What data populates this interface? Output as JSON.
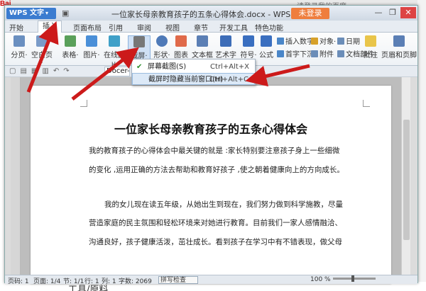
{
  "background": {
    "baidu_logo": "Bai",
    "bg_bottom_text": "工具/原料",
    "bg_top_text": "请登录我的百度"
  },
  "titlebar": {
    "app_button": "WPS 文字",
    "doc_title": "一位家长母亲教育孩子的五条心得体会.docx - WPS 文字",
    "login_button": "未登录",
    "minimize": "—",
    "maximize": "❐",
    "close": "✕"
  },
  "tabs": [
    {
      "label": "开始"
    },
    {
      "label": "插入"
    },
    {
      "label": "页面布局"
    },
    {
      "label": "引用"
    },
    {
      "label": "审阅"
    },
    {
      "label": "视图"
    },
    {
      "label": "章节"
    },
    {
      "label": "开发工具"
    },
    {
      "label": "特色功能"
    }
  ],
  "ribbon": {
    "page_break": "分页·",
    "blank_page": "空白页·",
    "table": "表格·",
    "picture": "图片·",
    "online_picture": "在线图片",
    "screenshot": "截屏·",
    "shapes": "形状·",
    "chart": "图表",
    "textbox": "文本框·",
    "wordart": "艺术字·",
    "symbol": "符号·",
    "formula": "公式",
    "insert_number": "插入数字",
    "object": "对象·",
    "date": "日期",
    "first_letter": "首字下沉",
    "attachment": "附件",
    "document_parts": "文档部件",
    "comment": "批注",
    "header_footer": "页眉和页脚"
  },
  "qtoolbar": {
    "doctab_label": "Docer-"
  },
  "dropdown": {
    "item1": "屏幕截图(S)",
    "item1_shortcut": "Ctrl+Alt+X",
    "item2": "截屏时隐藏当前窗口(H)",
    "item2_shortcut": "Ctrl+Alt+C"
  },
  "document": {
    "heading": "一位家长母亲教育孩子的五条心得体会",
    "p1_line1": "我的教育孩子的心得体会中最关键的就是 :家长特别要注意孩子身上一些细微",
    "p1_line2": "的变化 ,运用正确的方法去帮助和教育好孩子 ,使之朝着健康向上的方向成长。",
    "p2_line1": "我的女儿现在读五年级，从她出生到现在，我们努力做到科学施教，尽量",
    "p2_line2": "营造家庭的民主氛围和轻松环境来对她进行教育。目前我们一家人感情融洽、",
    "p2_line3": "沟通良好，孩子健康活泼，茁壮成长。看到孩子在学习中有不错表现，做父母"
  },
  "statusbar": {
    "page": "页码: 1",
    "pages": "页面: 1/4",
    "section": "节: 1/1",
    "row": "行: 1",
    "col": "列: 1",
    "words": "字数: 2069",
    "spell": "拼写检查",
    "zoom": "100 %"
  }
}
